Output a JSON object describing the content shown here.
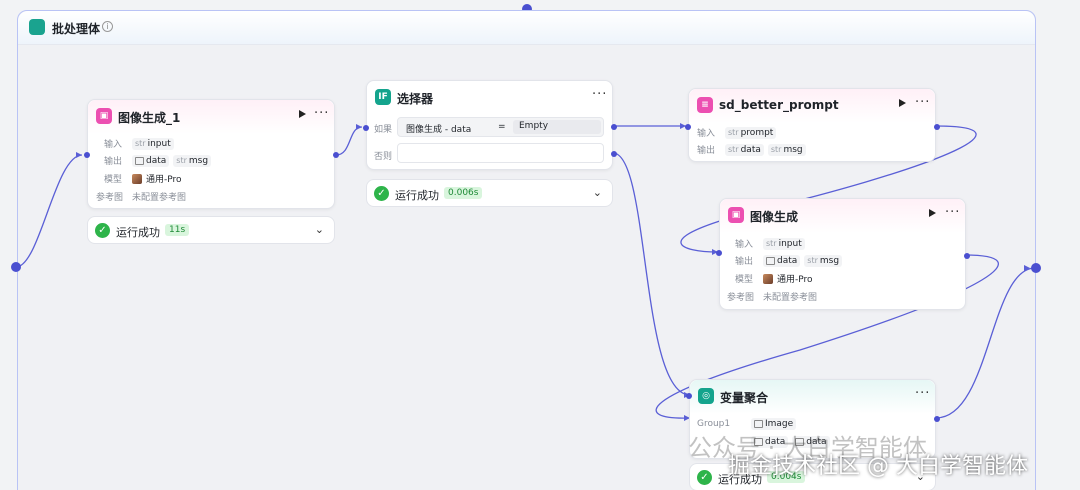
{
  "batch": {
    "title": "批处理体",
    "info_icon": "info-icon",
    "icon": "layers-icon"
  },
  "node_image1": {
    "title": "图像生成_1",
    "icon": "image-icon",
    "input_label": "输入",
    "input_type": "str",
    "input_name": "input",
    "output_label": "输出",
    "output_data": "data",
    "output_type": "str",
    "output_name": "msg",
    "model_label": "模型",
    "model_value": "通用-Pro",
    "ref_label": "参考图",
    "ref_value": "未配置参考图",
    "status": "运行成功",
    "time": "11s"
  },
  "node_selector": {
    "title": "选择器",
    "icon_text": "IF",
    "if_label": "如果",
    "cond_left": "图像生成 - data",
    "cond_op": "=",
    "cond_right": "Empty",
    "else_label": "否则",
    "status": "运行成功",
    "time": "0.006s"
  },
  "node_prompt": {
    "title": "sd_better_prompt",
    "icon": "list-icon",
    "input_label": "输入",
    "input_type": "str",
    "input_name": "prompt",
    "output_label": "输出",
    "out1_type": "str",
    "out1_name": "data",
    "out2_type": "str",
    "out2_name": "msg"
  },
  "node_image2": {
    "title": "图像生成",
    "icon": "image-icon",
    "input_label": "输入",
    "input_type": "str",
    "input_name": "input",
    "output_label": "输出",
    "output_data": "data",
    "output_type": "str",
    "output_name": "msg",
    "model_label": "模型",
    "model_value": "通用-Pro",
    "ref_label": "参考图",
    "ref_value": "未配置参考图"
  },
  "node_agg": {
    "title": "变量聚合",
    "icon": "aggregate-icon",
    "group_label": "Group1",
    "group_value": "Image",
    "row2": "data",
    "status": "运行成功",
    "time": "0.004s"
  },
  "watermark": {
    "line1": "公众号 · 大白学智能体",
    "line2": "掘金技术社区 @ 大白学智能体"
  },
  "colors": {
    "edge": "#5a5fd6",
    "success": "#2eb44a",
    "accent_pink": "#ec4fb1",
    "accent_teal": "#14a48d"
  }
}
